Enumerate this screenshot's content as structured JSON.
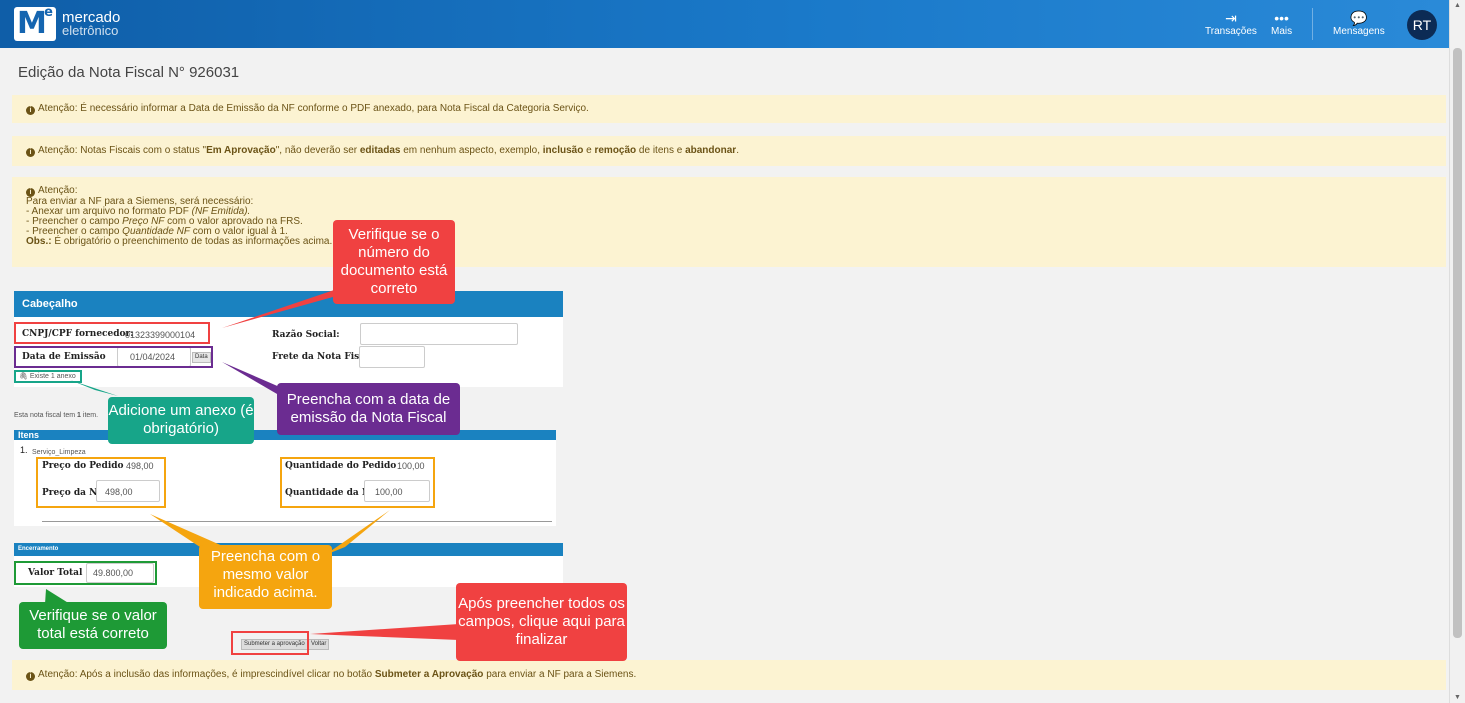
{
  "app": {
    "logo_line1": "mercado",
    "logo_line2": "eletrônico",
    "nav": [
      {
        "label": "Transações",
        "icon": "login-icon"
      },
      {
        "label": "Mais",
        "icon": "more-icon"
      },
      {
        "label": "Mensagens",
        "icon": "chat-icon"
      }
    ],
    "avatar": "RT"
  },
  "page": {
    "title": "Edição da Nota Fiscal N° 926031"
  },
  "alerts": {
    "a1": "Atenção: É necessário informar a Data de Emissão da NF conforme o PDF anexado, para Nota Fiscal da Categoria Serviço.",
    "a2_pre": "Atenção: Notas Fiscais com o status \"",
    "a2_b1": "Em Aprovação",
    "a2_mid1": "\", não deverão ser ",
    "a2_b2": "editadas",
    "a2_mid2": " em nenhum aspecto, exemplo, ",
    "a2_b3": "inclusão",
    "a2_mid3": " e ",
    "a2_b4": "remoção",
    "a2_mid4": " de itens e ",
    "a2_b5": "abandonar",
    "a2_end": ".",
    "a3_title": "Atenção:",
    "a3_l1": "Para enviar a NF para a Siemens, será necessário:",
    "a3_l2_pre": "- Anexar um arquivo no formato PDF ",
    "a3_l2_em": "(NF Emitida).",
    "a3_l3_pre": "- Preencher o campo ",
    "a3_l3_em": "Preço NF",
    "a3_l3_post": " com o valor aprovado na FRS.",
    "a3_l4_pre": "- Preencher o campo ",
    "a3_l4_em": "Quantidade NF",
    "a3_l4_post": " com o valor igual à 1.",
    "a3_l5_b": "Obs.:",
    "a3_l5": " É obrigatório o preenchimento de todas as informações acima.",
    "a4_pre": "Atenção: Após a inclusão das informações, é imprescindível clicar no botão ",
    "a4_b": "Submeter a Aprovação",
    "a4_post": " para enviar a NF para a Siemens."
  },
  "header_panel": {
    "title": "Cabeçalho",
    "cnpj_label": "CNPJ/CPF fornecedor:",
    "cnpj_value": "01323399000104",
    "razao_label": "Razão Social:",
    "razao_value": "",
    "data_label": "Data de Emissão",
    "data_value": "01/04/2024",
    "data_button": "Data",
    "frete_label": "Frete da Nota Fiscal:",
    "frete_value": "",
    "anexo": "Existe 1 anexo"
  },
  "items_panel": {
    "summary_pre": "Esta nota fiscal tem ",
    "summary_count": "1",
    "summary_post": " item.",
    "title": "Itens",
    "item_index": "1.",
    "item_name": "Serviço_Limpeza",
    "preco_pedido_label": "Preço do Pedido",
    "preco_pedido_value": "498,00",
    "preco_nf_label": "Preço da NF",
    "preco_nf_value": "498,00",
    "qtd_pedido_label": "Quantidade do Pedido",
    "qtd_pedido_value": "100,00",
    "qtd_nf_label": "Quantidade da NF",
    "qtd_nf_value": "100,00"
  },
  "closing_panel": {
    "title": "Encerramento",
    "total_label": "Valor Total",
    "total_value": "49.800,00"
  },
  "buttons": {
    "submit": "Submeter a aprovação",
    "back": "Voltar"
  },
  "callouts": {
    "c1": "Verifique se o número do documento está correto",
    "c2": "Preencha com a data de emissão da Nota Fiscal",
    "c3": "Adicione um anexo (é obrigatório)",
    "c4": "Preencha com o mesmo valor indicado acima.",
    "c5": "Verifique se o valor total está correto",
    "c6": "Após preencher todos os campos, clique aqui para finalizar"
  },
  "colors": {
    "red": "#f04141",
    "purple": "#6b2c91",
    "teal": "#17a589",
    "orange": "#f5a50f",
    "green": "#1e9a36",
    "blue": "#1a82c0"
  }
}
